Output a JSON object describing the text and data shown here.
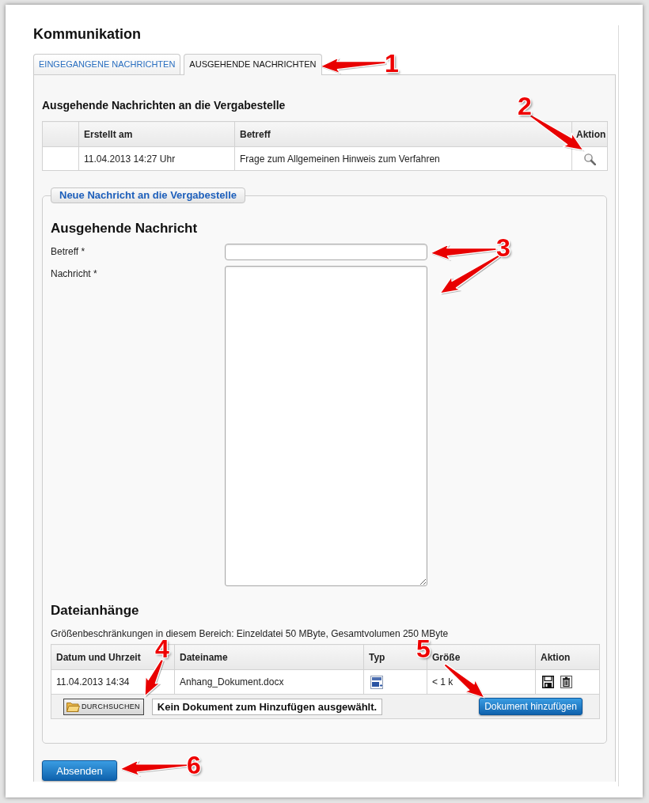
{
  "page": {
    "title": "Kommunikation"
  },
  "tabs": [
    {
      "label": "EINGEGANGENE NACHRICHTEN",
      "selected": false
    },
    {
      "label": "AUSGEHENDE NACHRICHTEN",
      "selected": true
    }
  ],
  "outgoing_messages": {
    "title": "Ausgehende Nachrichten an die Vergabestelle",
    "columns": [
      {
        "kind": "blank"
      },
      {
        "kind": "label",
        "label": "Erstellt am"
      },
      {
        "kind": "label",
        "label": "Betreff"
      },
      {
        "kind": "label",
        "label": "Aktion"
      }
    ],
    "rows": [
      {
        "created": "11.04.2013 14:27 Uhr",
        "subject": "Frage zum Allgemeinen Hinweis zum Verfahren"
      }
    ]
  },
  "new_message": {
    "legend": "Neue Nachricht an die Vergabestelle",
    "title": "Ausgehende Nachricht",
    "fields": [
      {
        "kind": "text",
        "label": "Betreff *"
      },
      {
        "kind": "textarea",
        "label": "Nachricht *"
      }
    ],
    "attachments": {
      "title": "Dateianhänge",
      "note": "Größenbeschränkungen in diesem Bereich: Einzeldatei 50 MByte, Gesamtvolumen 250 MByte",
      "columns": [
        "Datum und Uhrzeit",
        "Dateiname",
        "Typ",
        "Größe",
        "Aktion"
      ],
      "rows": [
        {
          "date": "11.04.2013 14:34",
          "filename": "Anhang_Dokument.docx",
          "size": "< 1 k"
        }
      ],
      "browse_button": "DURCHSUCHEN",
      "file_status": "Kein Dokument zum Hinzufügen ausgewählt.",
      "add_button": "Dokument hinzufügen"
    }
  },
  "submit_button": "Absenden",
  "annotations": [
    {
      "number": "1"
    },
    {
      "number": "2"
    },
    {
      "number": "3"
    },
    {
      "number": "4"
    },
    {
      "number": "5"
    },
    {
      "number": "6"
    }
  ]
}
